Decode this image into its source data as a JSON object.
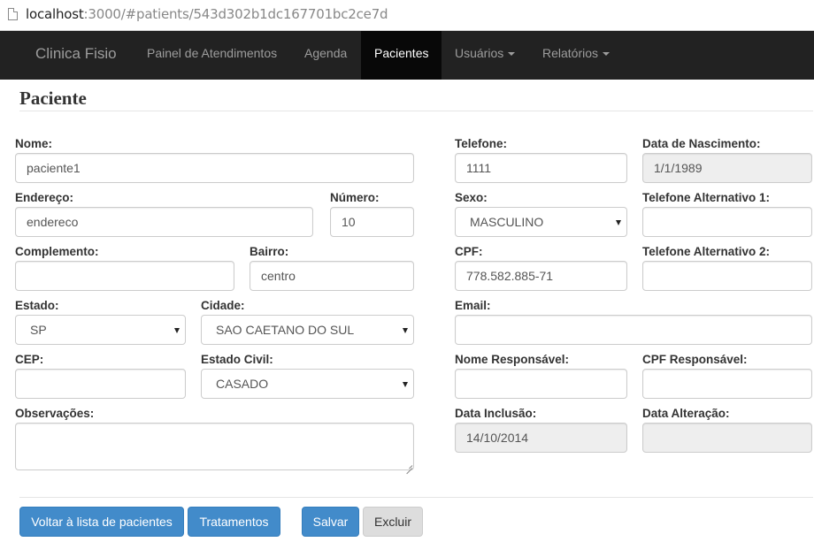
{
  "browser": {
    "url_host": "localhost",
    "url_path": ":3000/#patients/543d302b1dc167701bc2ce7d"
  },
  "navbar": {
    "brand": "Clinica Fisio",
    "items": [
      {
        "label": "Painel de Atendimentos"
      },
      {
        "label": "Agenda"
      },
      {
        "label": "Pacientes",
        "active": true
      },
      {
        "label": "Usuários",
        "dropdown": true
      },
      {
        "label": "Relatórios",
        "dropdown": true
      }
    ]
  },
  "page": {
    "title": "Paciente"
  },
  "form": {
    "nome": {
      "label": "Nome:",
      "value": "paciente1"
    },
    "endereco": {
      "label": "Endereço:",
      "value": "endereco"
    },
    "numero": {
      "label": "Número:",
      "value": "10"
    },
    "complemento": {
      "label": "Complemento:",
      "value": ""
    },
    "bairro": {
      "label": "Bairro:",
      "value": "centro"
    },
    "estado": {
      "label": "Estado:",
      "value": "SP"
    },
    "cidade": {
      "label": "Cidade:",
      "value": "SAO CAETANO DO SUL"
    },
    "cep": {
      "label": "CEP:",
      "value": ""
    },
    "estado_civil": {
      "label": "Estado Civil:",
      "value": "CASADO"
    },
    "observacoes": {
      "label": "Observações:",
      "value": ""
    },
    "telefone": {
      "label": "Telefone:",
      "value": "1111"
    },
    "data_nascimento": {
      "label": "Data de Nascimento:",
      "value": "1/1/1989"
    },
    "sexo": {
      "label": "Sexo:",
      "value": "MASCULINO"
    },
    "telefone_alt1": {
      "label": "Telefone Alternativo 1:",
      "value": ""
    },
    "cpf": {
      "label": "CPF:",
      "value": "778.582.885-71"
    },
    "telefone_alt2": {
      "label": "Telefone Alternativo 2:",
      "value": ""
    },
    "email": {
      "label": "Email:",
      "value": ""
    },
    "nome_responsavel": {
      "label": "Nome Responsável:",
      "value": ""
    },
    "cpf_responsavel": {
      "label": "CPF Responsável:",
      "value": ""
    },
    "data_inclusao": {
      "label": "Data Inclusão:",
      "value": "14/10/2014"
    },
    "data_alteracao": {
      "label": "Data Alteração:",
      "value": ""
    }
  },
  "actions": {
    "back": "Voltar à lista de pacientes",
    "treatments": "Tratamentos",
    "save": "Salvar",
    "delete": "Excluir"
  },
  "colors": {
    "navbar_bg": "#222222",
    "navbar_active_bg": "#080808",
    "primary": "#428bca",
    "readonly_bg": "#eeeeee"
  }
}
